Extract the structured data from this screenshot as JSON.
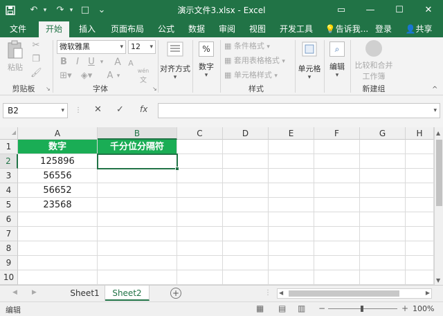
{
  "app": {
    "title": "演示文件3.xlsx - Excel",
    "quick_access": {
      "save_icon": "save-icon",
      "undo": "↶",
      "redo": "↷",
      "new": "□",
      "customize": "⌄"
    },
    "window_controls": {
      "restore_ribbon": "▭",
      "minimize": "—",
      "maximize": "☐",
      "close": "✕"
    }
  },
  "tabs": [
    "文件",
    "开始",
    "插入",
    "页面布局",
    "公式",
    "数据",
    "审阅",
    "视图",
    "开发工具"
  ],
  "active_tab": "开始",
  "tell_me": "告诉我...",
  "login": "登录",
  "share": "共享",
  "ribbon": {
    "clipboard": {
      "paste": "粘贴",
      "label": "剪贴板"
    },
    "font": {
      "name": "微软雅黑",
      "size": "12",
      "bold": "B",
      "italic": "I",
      "underline": "U",
      "grow": "A",
      "shrink": "A",
      "color_a": "A",
      "wen": "wén",
      "wen2": "文",
      "label": "字体"
    },
    "align": {
      "label": "对齐方式"
    },
    "number": {
      "symbol": "%",
      "label": "数字"
    },
    "styles": {
      "conditional": "条件格式",
      "table": "套用表格格式",
      "cell": "单元格样式",
      "label": "样式"
    },
    "cells": {
      "label": "单元格"
    },
    "editing": {
      "label": "编辑"
    },
    "compare": {
      "line1": "比较和合并",
      "line2": "工作簿",
      "label": "新建组"
    }
  },
  "formula_bar": {
    "name_box": "B2",
    "cancel": "✕",
    "enter": "✓",
    "fx": "fx",
    "value": ""
  },
  "columns": [
    "A",
    "B",
    "C",
    "D",
    "E",
    "F",
    "G",
    "H"
  ],
  "rows": [
    "1",
    "2",
    "3",
    "4",
    "5",
    "6",
    "7",
    "8",
    "9",
    "10"
  ],
  "cells": {
    "a1": "数字",
    "b1": "千分位分隔符",
    "a_values": [
      "125896",
      "56556",
      "56652",
      "23568"
    ]
  },
  "sheet_tabs": [
    "Sheet1",
    "Sheet2"
  ],
  "active_sheet": "Sheet2",
  "add_sheet": "+",
  "status": {
    "mode": "编辑",
    "zoom": "100%",
    "zoom_minus": "−",
    "zoom_plus": "+"
  },
  "colors": {
    "brand": "#217346",
    "header_fill": "#1aad55"
  }
}
